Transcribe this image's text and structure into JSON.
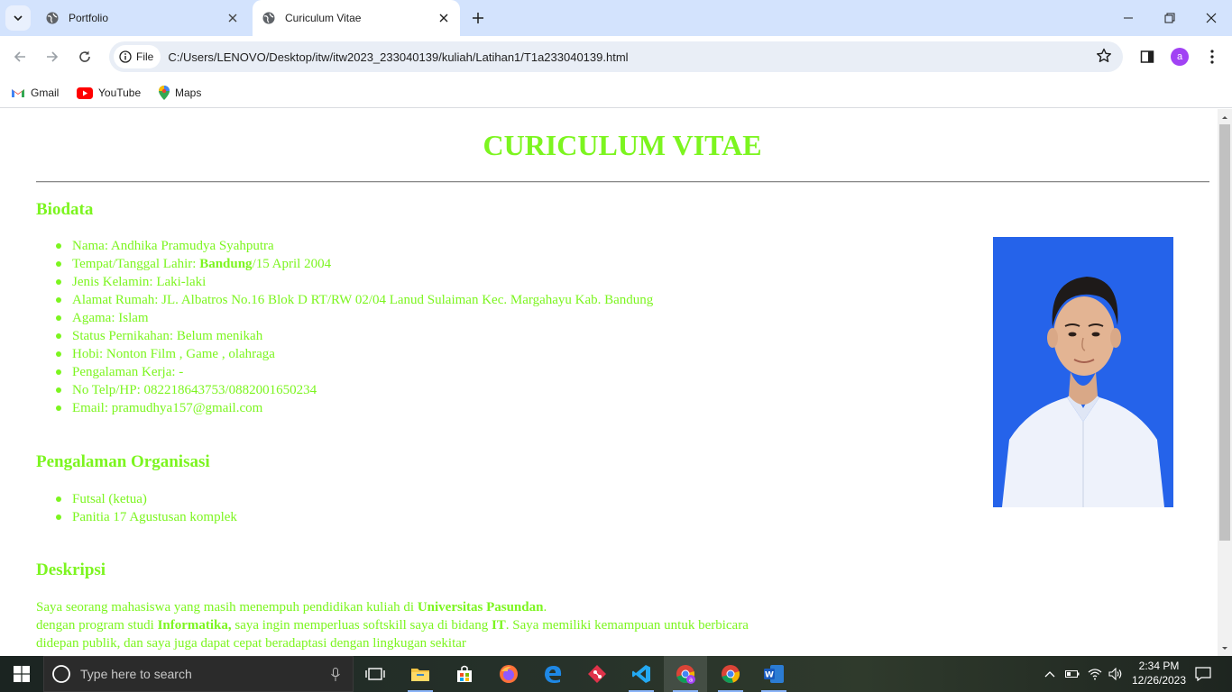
{
  "browser": {
    "tabs": [
      {
        "title": "Portfolio",
        "active": false
      },
      {
        "title": "Curiculum Vitae",
        "active": true
      }
    ],
    "address": {
      "scheme_label": "File",
      "url": "C:/Users/LENOVO/Desktop/itw/itw2023_233040139/kuliah/Latihan1/T1a233040139.html"
    },
    "profile_initial": "a",
    "bookmarks": [
      "Gmail",
      "YouTube",
      "Maps"
    ]
  },
  "page": {
    "title": "CURICULUM VITAE",
    "text_color": "#7cf51f",
    "biodata": {
      "heading": "Biodata",
      "items": [
        {
          "label": "Nama: Andhika Pramudya Syahputra"
        },
        {
          "label_prefix": "Tempat/Tanggal Lahir: ",
          "bold": "Bandung",
          "label_suffix": "/15 April 2004"
        },
        {
          "label": "Jenis Kelamin: Laki-laki"
        },
        {
          "label": "Alamat Rumah: JL. Albatros No.16 Blok D RT/RW 02/04 Lanud Sulaiman Kec. Margahayu Kab. Bandung"
        },
        {
          "label": "Agama: Islam"
        },
        {
          "label": "Status Pernikahan: Belum menikah"
        },
        {
          "label": "Hobi: Nonton Film , Game , olahraga"
        },
        {
          "label": "Pengalaman Kerja: -"
        },
        {
          "label": "No Telp/HP: 082218643753/0882001650234"
        },
        {
          "label": "Email: pramudhya157@gmail.com"
        }
      ]
    },
    "organisasi": {
      "heading": "Pengalaman Organisasi",
      "items": [
        "Futsal (ketua)",
        "Panitia 17 Agustusan komplek"
      ]
    },
    "deskripsi": {
      "heading": "Deskripsi",
      "line1_a": "Saya seorang mahasiswa yang masih menempuh pendidikan kuliah di ",
      "line1_bold": "Universitas Pasundan",
      "line1_b": ".",
      "line2_a": "dengan program studi ",
      "line2_bold1": "Informatika,",
      "line2_b": " saya ingin memperluas softskill saya di bidang ",
      "line2_bold2": "IT",
      "line2_c": ". Saya memiliki kemampuan untuk berbicara",
      "line3": "didepan publik, dan saya juga dapat cepat beradaptasi dengan lingkugan sekitar"
    }
  },
  "taskbar": {
    "search_placeholder": "Type here to search",
    "time": "2:34 PM",
    "date": "12/26/2023",
    "apps": [
      "task-view",
      "file-explorer",
      "microsoft-store",
      "firefox",
      "edge",
      "git-tool",
      "vscode",
      "chrome-profile",
      "chrome",
      "word"
    ]
  }
}
